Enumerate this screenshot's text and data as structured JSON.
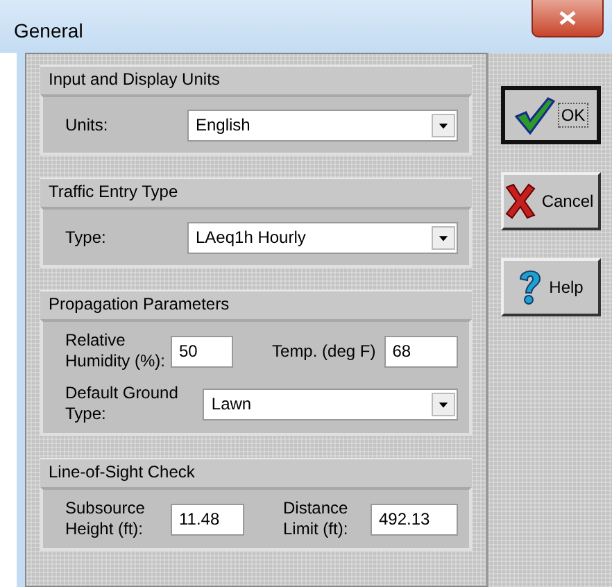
{
  "window": {
    "title": "General"
  },
  "groups": [
    {
      "title": "Input and Display Units",
      "rows": [
        [
          {
            "kind": "label",
            "text": "Units:"
          },
          {
            "kind": "select",
            "value": "English"
          }
        ]
      ]
    },
    {
      "title": "Traffic Entry Type",
      "rows": [
        [
          {
            "kind": "label",
            "text": "Type:"
          },
          {
            "kind": "select",
            "value": "LAeq1h Hourly"
          }
        ]
      ]
    },
    {
      "title": "Propagation Parameters",
      "rows": [
        [
          {
            "kind": "label",
            "text": "Relative\nHumidity (%):"
          },
          {
            "kind": "input",
            "value": "50"
          },
          {
            "kind": "label",
            "text": "Temp. (deg F)"
          },
          {
            "kind": "input",
            "value": "68"
          }
        ],
        [
          {
            "kind": "label",
            "text": "Default Ground\nType:"
          },
          {
            "kind": "select",
            "value": "Lawn"
          }
        ]
      ]
    },
    {
      "title": "Line-of-Sight Check",
      "rows": [
        [
          {
            "kind": "label",
            "text": "Subsource\nHeight (ft):"
          },
          {
            "kind": "input",
            "value": "11.48"
          },
          {
            "kind": "label",
            "text": "Distance\nLimit (ft):"
          },
          {
            "kind": "input",
            "value": "492.13"
          }
        ]
      ]
    }
  ],
  "buttons": [
    {
      "label": "OK",
      "kind": "check",
      "default": true
    },
    {
      "label": "Cancel",
      "kind": "cross",
      "default": false
    },
    {
      "label": "Help",
      "kind": "question",
      "default": false
    }
  ]
}
